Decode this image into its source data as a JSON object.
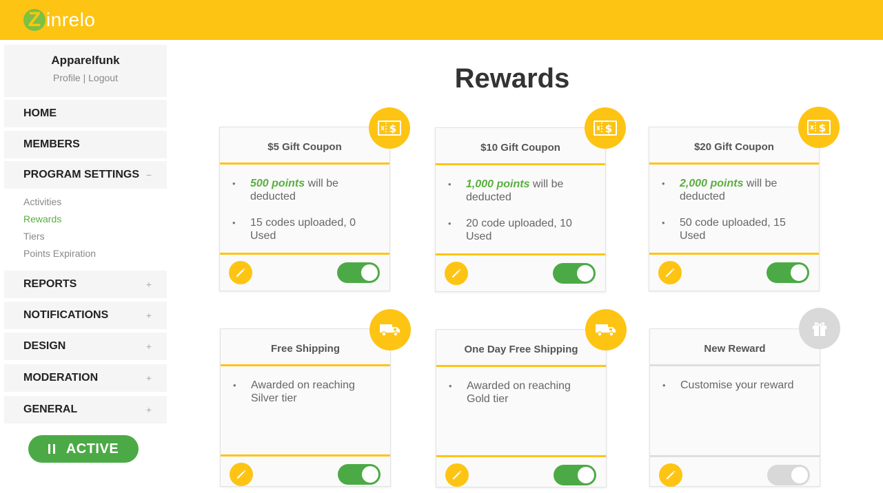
{
  "app": {
    "logo_letter": "Z",
    "logo_text": "inrelo",
    "brand_color": "#fec414",
    "accent_green": "#5aae3f"
  },
  "profile": {
    "name": "Apparelfunk",
    "profile_link": "Profile",
    "separator": "|",
    "logout_link": "Logout"
  },
  "nav": {
    "home": "HOME",
    "members": "MEMBERS",
    "program_settings": "PROGRAM SETTINGS",
    "program_settings_toggle": "−",
    "sub_items": [
      "Activities",
      "Rewards",
      "Tiers",
      "Points Expiration"
    ],
    "reports": "REPORTS",
    "notifications": "NOTIFICATIONS",
    "design": "DESIGN",
    "moderation": "MODERATION",
    "general": "GENERAL",
    "expand_toggle": "+"
  },
  "status_button": {
    "label": "ACTIVE",
    "icon": "pause-icon"
  },
  "page": {
    "title": "Rewards"
  },
  "rewards": [
    {
      "title": "$5 Gift Coupon",
      "points": "500 points",
      "points_suffix": " will be deducted",
      "line2": "15 codes uploaded, 0 Used",
      "icon": "coupon-icon",
      "enabled": true
    },
    {
      "title": "$10 Gift Coupon",
      "points": "1,000 points",
      "points_suffix": " will be deducted",
      "line2": "20 code uploaded, 10 Used",
      "icon": "coupon-icon",
      "enabled": true
    },
    {
      "title": "$20 Gift Coupon",
      "points": "2,000 points",
      "points_suffix": " will be deducted",
      "line2": "50 code uploaded, 15 Used",
      "icon": "coupon-icon",
      "enabled": true
    },
    {
      "title": "Free Shipping",
      "line1": "Awarded on reaching Silver tier",
      "icon": "truck-icon",
      "enabled": true
    },
    {
      "title": "One Day Free Shipping",
      "line1": "Awarded on reaching Gold tier",
      "icon": "truck-icon",
      "enabled": true
    },
    {
      "title": "New Reward",
      "line1": "Customise your reward",
      "icon": "gift-icon",
      "enabled": false
    }
  ]
}
